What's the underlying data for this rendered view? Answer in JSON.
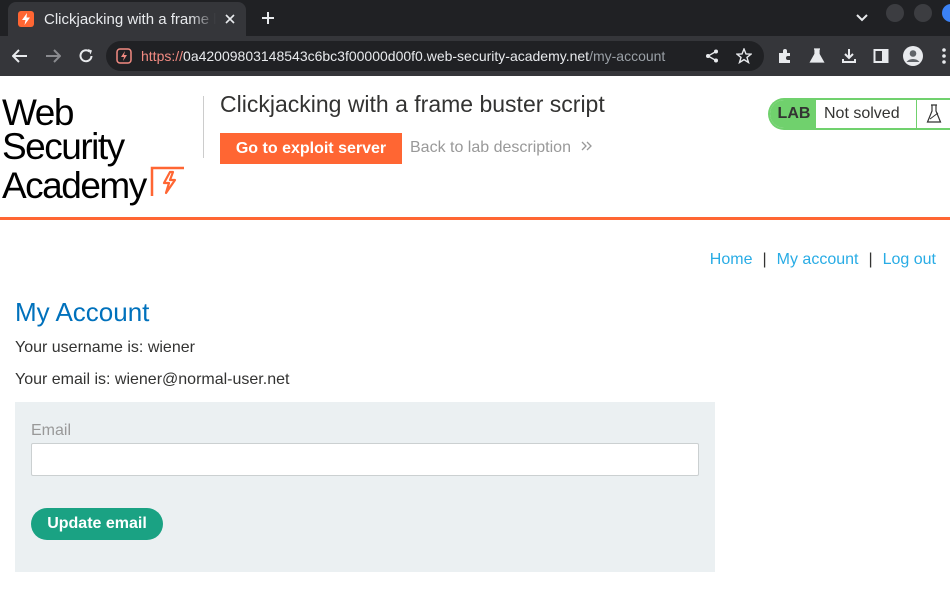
{
  "browser": {
    "tab_title": "Clickjacking with a frame buster script",
    "url_scheme": "https://",
    "url_host": "0a42009803148543c6bc3f00000d00f0.web-security-academy.net",
    "url_path": "/my-account"
  },
  "header": {
    "logo_line1": "Web Security",
    "logo_line2": "Academy",
    "lab_title": "Clickjacking with a frame buster script",
    "exploit_button": "Go to exploit server",
    "back_link": "Back to lab description",
    "lab_badge": "LAB",
    "lab_status": "Not solved"
  },
  "nav": {
    "home": "Home",
    "separator": "|",
    "my_account": "My account",
    "log_out": "Log out"
  },
  "main": {
    "title": "My Account",
    "username_line": "Your username is: wiener",
    "email_line": "Your email is: wiener@normal-user.net",
    "email_label": "Email",
    "email_value": "",
    "update_button": "Update email"
  },
  "colors": {
    "brand_orange": "#ff6633",
    "lab_green": "#70d16d",
    "link_blue": "#29ace5",
    "heading_blue": "#0071bc",
    "button_teal": "#1aa283",
    "panel_bg": "#ebf0f2"
  }
}
